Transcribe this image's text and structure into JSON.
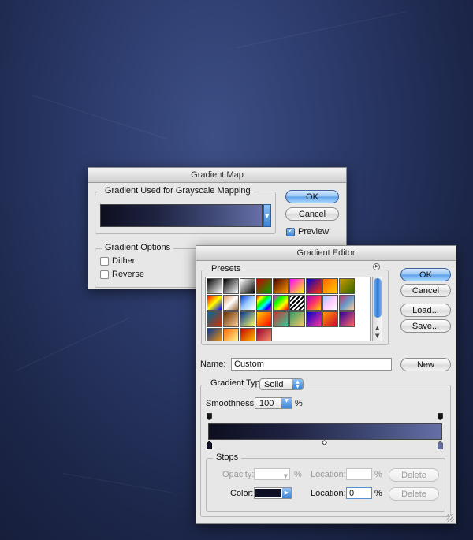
{
  "gradient_map": {
    "title": "Gradient Map",
    "group_mapping_title": "Gradient Used for Grayscale Mapping",
    "ok_label": "OK",
    "cancel_label": "Cancel",
    "preview_label": "Preview",
    "preview_checked": true,
    "options_title": "Gradient Options",
    "dither_label": "Dither",
    "dither_checked": false,
    "reverse_label": "Reverse",
    "reverse_checked": false
  },
  "gradient_editor": {
    "title": "Gradient Editor",
    "presets_title": "Presets",
    "ok_label": "OK",
    "cancel_label": "Cancel",
    "load_label": "Load...",
    "save_label": "Save...",
    "name_label": "Name:",
    "name_value": "Custom",
    "new_label": "New",
    "gradient_type_label": "Gradient Type:",
    "gradient_type_value": "Solid",
    "smoothness_label": "Smoothness:",
    "smoothness_value": "100",
    "percent": "%",
    "stops_title": "Stops",
    "opacity_label": "Opacity:",
    "opacity_value": "",
    "location_label": "Location:",
    "opacity_location_value": "",
    "delete_label": "Delete",
    "color_label": "Color:",
    "color_value": "#0d0f24",
    "color_location_value": "0"
  },
  "gradient_colors": [
    "#0d0f1f",
    "#1e2240",
    "#3c4671",
    "#6670a8"
  ],
  "icons": {
    "presets_menu": "circle-arrow-icon",
    "popup": "up-down-arrows-icon"
  }
}
